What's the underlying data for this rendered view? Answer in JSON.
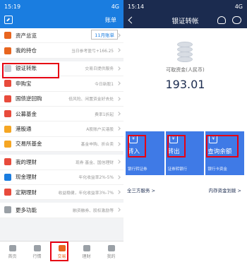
{
  "left": {
    "status": {
      "time": "15:19",
      "signal": "4G"
    },
    "bill_label": "账单",
    "bill_badge": "11月账单",
    "menu": [
      {
        "label": "资产总览",
        "sub": "",
        "color": "#e8651f"
      },
      {
        "label": "我的持仓",
        "sub": "当日参考盈亏+166.25",
        "color": "#e8651f"
      },
      {
        "label": "银证转账",
        "sub": "交易日提供服务",
        "color": "#c7cdd4"
      },
      {
        "label": "申购宝",
        "sub": "今日新股1",
        "color": "#e84b3c"
      },
      {
        "label": "国债逆回购",
        "sub": "低风险、闲置资金好去处",
        "color": "#e84b3c"
      },
      {
        "label": "公募基金",
        "sub": "费率1折起",
        "color": "#e84b3c"
      },
      {
        "label": "港股通",
        "sub": "A股账户买港股",
        "color": "#f5a623"
      },
      {
        "label": "交易所基金",
        "sub": "基金申购、折合卖",
        "color": "#f5a623"
      },
      {
        "label": "我的理财",
        "sub": "现券 基金、国信理财",
        "color": "#e84b3c"
      },
      {
        "label": "现金理财",
        "sub": "年化收益率2%-5%",
        "color": "#1a7de0"
      },
      {
        "label": "定期理财",
        "sub": "收益稳健，年化收益率3%-7%",
        "color": "#e84b3c"
      },
      {
        "label": "更多功能",
        "sub": "融资融券、股权激励等",
        "color": "#9aa0a6"
      }
    ],
    "tabs": [
      "首页",
      "行情",
      "交易",
      "理财",
      "我的"
    ]
  },
  "right": {
    "status": {
      "time": "15:14",
      "signal": "4G"
    },
    "title": "银证转帐",
    "avail_label": "可取资金(人民币)",
    "avail_value": "193.01",
    "cards": [
      {
        "label": "转入",
        "sub": "银行转证券"
      },
      {
        "label": "转出",
        "sub": "证券转银行"
      },
      {
        "label": "查询余额",
        "sub": "银行卡资金"
      }
    ],
    "link_left": "全三方服务 >",
    "link_right": "内存资金划拨 >"
  }
}
